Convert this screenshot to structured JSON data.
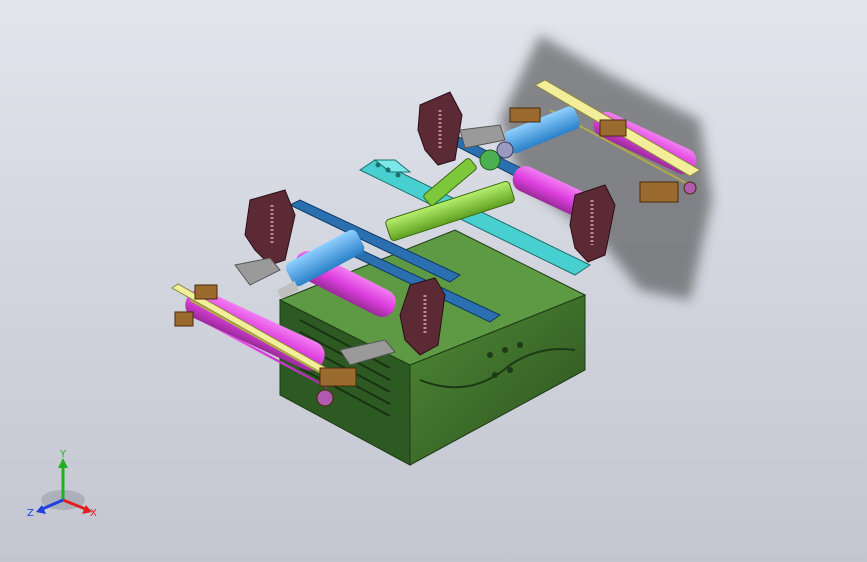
{
  "viewport": {
    "background_top": "#e2e5ec",
    "background_bottom": "#c3c6d0"
  },
  "triad": {
    "x_label": "X",
    "y_label": "Y",
    "z_label": "Z",
    "x_color": "#e02020",
    "y_color": "#20b020",
    "z_color": "#2040e0"
  },
  "parts": {
    "frame_color": "#3d6b2a",
    "bracket_color": "#5c2a35",
    "roller_color": "#e040e0",
    "cylinder_color": "#4aa8e8",
    "beam_color": "#2a6fb0",
    "crossbar_color": "#48d0d0",
    "rail_color": "#f2ee9a",
    "linkage_color": "#8ad23a",
    "block_color": "#9a6a2e"
  }
}
